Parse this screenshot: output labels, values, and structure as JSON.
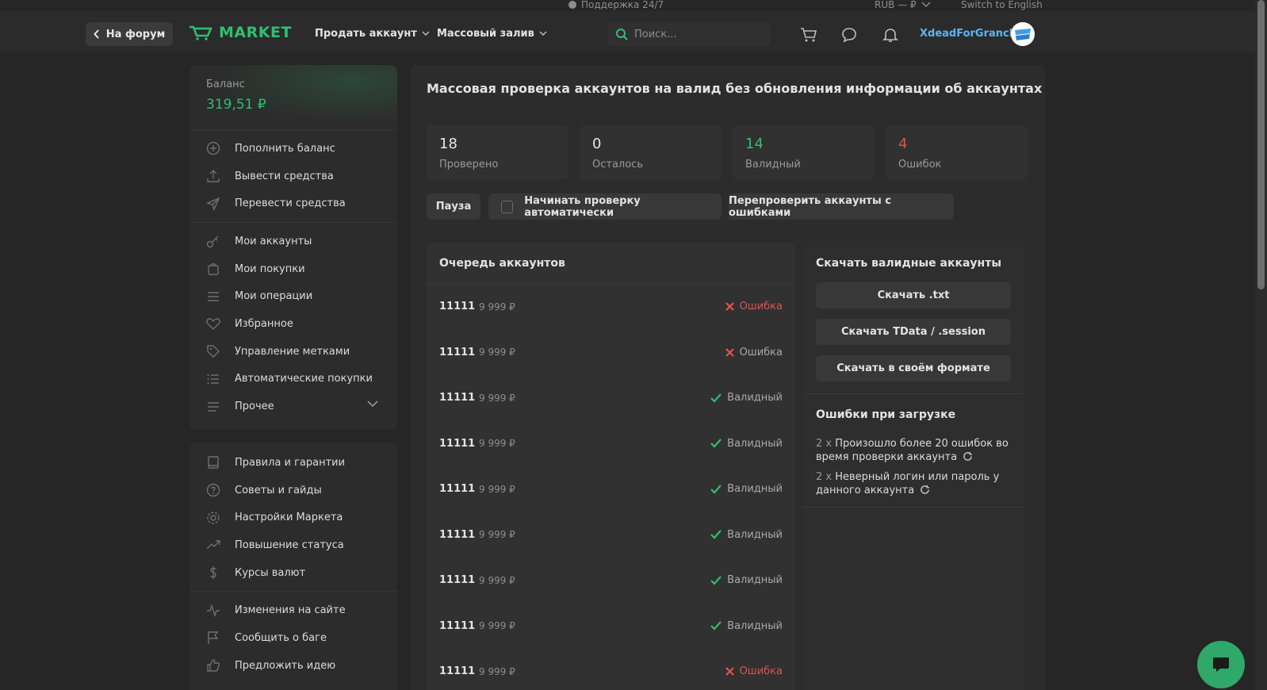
{
  "topbar": {
    "support": "Поддержка 24/7",
    "currency": "RUB — ₽",
    "language": "Switch to English"
  },
  "header": {
    "back_label": "На форум",
    "logo_text": "MARKET",
    "nav": [
      "Продать аккаунт",
      "Массовый залив"
    ],
    "search_placeholder": "Поиск...",
    "username": "XdeadForGranch"
  },
  "sidebar": {
    "balance_label": "Баланс",
    "balance_value": "319,51 ₽",
    "group1": [
      "Пополнить баланс",
      "Вывести средства",
      "Перевести средства"
    ],
    "group2": [
      "Мои аккаунты",
      "Мои покупки",
      "Мои операции",
      "Избранное",
      "Управление метками",
      "Автоматические покупки",
      "Прочее"
    ],
    "group3": [
      "Правила и гарантии",
      "Советы и гайды",
      "Настройки Маркета",
      "Повышение статуса",
      "Курсы валют"
    ],
    "group4": [
      "Изменения на сайте",
      "Сообщить о баге",
      "Предложить идею"
    ]
  },
  "main": {
    "title": "Массовая проверка аккаунтов на валид без обновления информации об аккаунтах",
    "stats": [
      {
        "value": "18",
        "label": "Проверено",
        "color": "#e6e6e6"
      },
      {
        "value": "0",
        "label": "Осталось",
        "color": "#e6e6e6"
      },
      {
        "value": "14",
        "label": "Валидный",
        "color": "#2fbf71"
      },
      {
        "value": "4",
        "label": "Ошибок",
        "color": "#e05252"
      }
    ],
    "pause_label": "Пауза",
    "auto_check_label": "Начинать проверку автоматически",
    "recheck_label": "Перепроверить аккаунты с ошибками",
    "queue_title": "Очередь аккаунтов",
    "queue": [
      {
        "id": "11111",
        "price": "9 999 ₽",
        "status": "Ошибка",
        "kind": "err"
      },
      {
        "id": "11111",
        "price": "9 999 ₽",
        "status": "Ошибка",
        "kind": "err-grey"
      },
      {
        "id": "11111",
        "price": "9 999 ₽",
        "status": "Валидный",
        "kind": "valid"
      },
      {
        "id": "11111",
        "price": "9 999 ₽",
        "status": "Валидный",
        "kind": "valid"
      },
      {
        "id": "11111",
        "price": "9 999 ₽",
        "status": "Валидный",
        "kind": "valid"
      },
      {
        "id": "11111",
        "price": "9 999 ₽",
        "status": "Валидный",
        "kind": "valid"
      },
      {
        "id": "11111",
        "price": "9 999 ₽",
        "status": "Валидный",
        "kind": "valid"
      },
      {
        "id": "11111",
        "price": "9 999 ₽",
        "status": "Валидный",
        "kind": "valid"
      },
      {
        "id": "11111",
        "price": "9 999 ₽",
        "status": "Ошибка",
        "kind": "err"
      }
    ],
    "download_title": "Скачать валидные аккаунты",
    "download_buttons": [
      "Скачать .txt",
      "Скачать TData / .session",
      "Скачать в своём формате"
    ],
    "errors_title": "Ошибки при загрузке",
    "errors": [
      {
        "count": "2 x",
        "text": "Произошло более 20 ошибок во время проверки аккаунта"
      },
      {
        "count": "2 x",
        "text": "Неверный логин или пароль у данного аккаунта"
      }
    ]
  },
  "colors": {
    "accent": "#2fbf71",
    "error": "#e05252",
    "link": "#62b3f0"
  }
}
